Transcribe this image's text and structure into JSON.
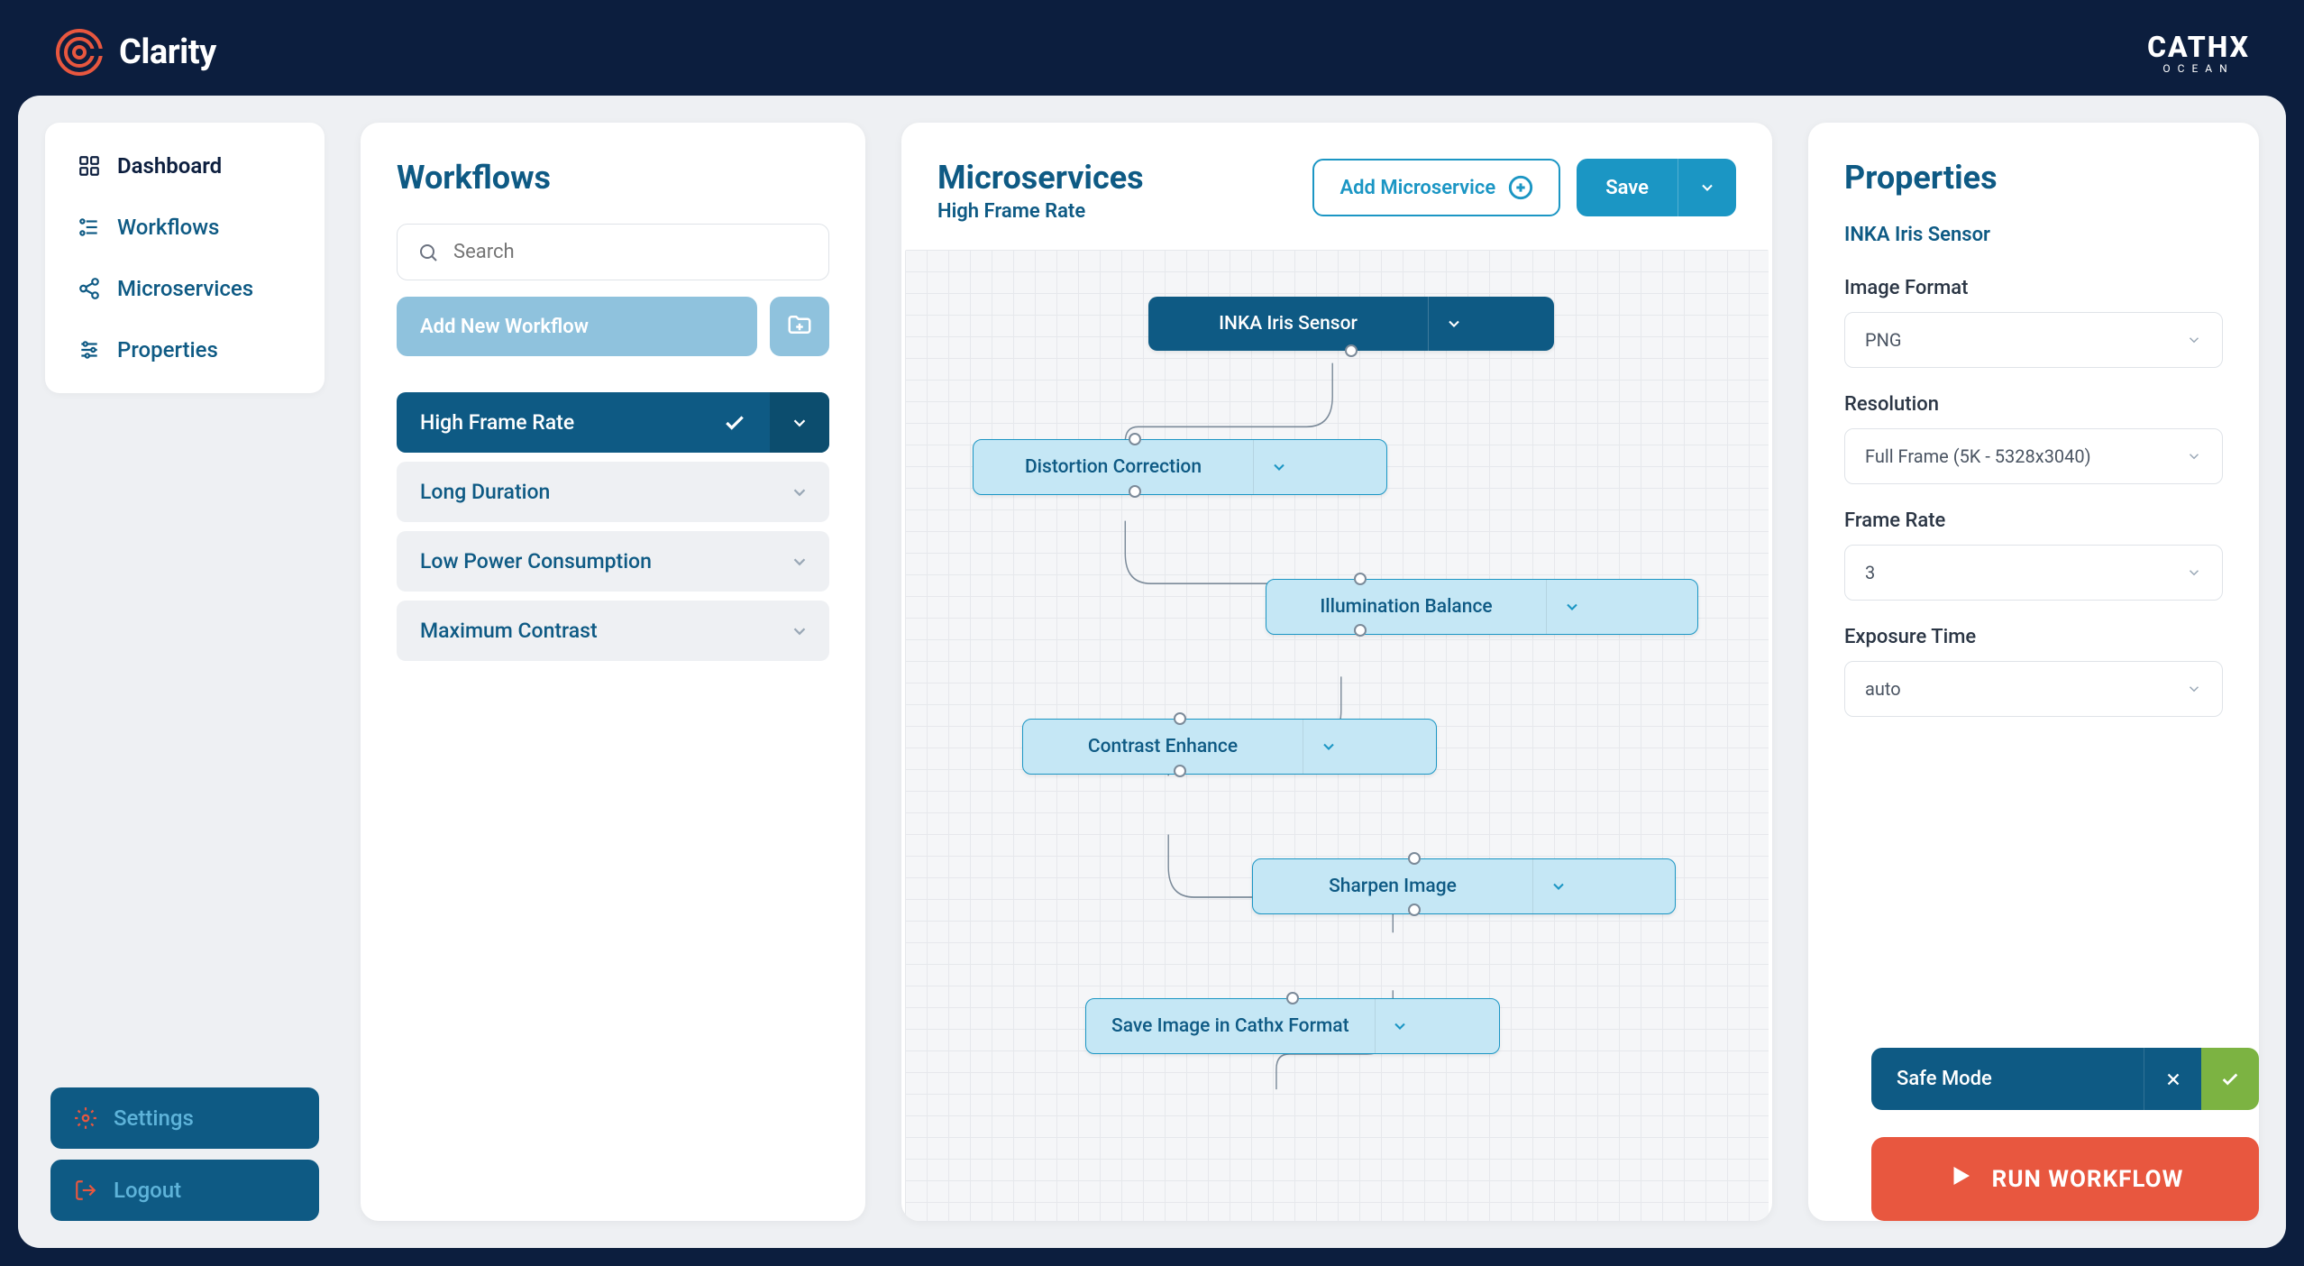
{
  "header": {
    "brand": "Clarity",
    "right_top": "CATHX",
    "right_bottom": "OCEAN"
  },
  "sidebar": {
    "items": [
      {
        "label": "Dashboard"
      },
      {
        "label": "Workflows"
      },
      {
        "label": "Microservices"
      },
      {
        "label": "Properties"
      }
    ],
    "settings": "Settings",
    "logout": "Logout"
  },
  "workflows": {
    "title": "Workflows",
    "search_placeholder": "Search",
    "add_label": "Add New Workflow",
    "items": [
      {
        "label": "High Frame Rate",
        "active": true
      },
      {
        "label": "Long Duration",
        "active": false
      },
      {
        "label": "Low Power Consumption",
        "active": false
      },
      {
        "label": "Maximum Contrast",
        "active": false
      }
    ]
  },
  "microservices": {
    "title": "Microservices",
    "subtitle": "High Frame Rate",
    "add_label": "Add Microservice",
    "save_label": "Save",
    "nodes": [
      {
        "label": "INKA Iris Sensor"
      },
      {
        "label": "Distortion Correction"
      },
      {
        "label": "Illumination Balance"
      },
      {
        "label": "Contrast Enhance"
      },
      {
        "label": "Sharpen Image"
      },
      {
        "label": "Save Image in Cathx Format"
      }
    ]
  },
  "properties": {
    "title": "Properties",
    "subtitle": "INKA Iris Sensor",
    "fields": [
      {
        "label": "Image Format",
        "value": "PNG"
      },
      {
        "label": "Resolution",
        "value": "Full Frame (5K - 5328x3040)"
      },
      {
        "label": "Frame Rate",
        "value": "3"
      },
      {
        "label": "Exposure Time",
        "value": "auto"
      }
    ]
  },
  "overlay": {
    "safe_mode": "Safe Mode",
    "run": "RUN WORKFLOW"
  }
}
